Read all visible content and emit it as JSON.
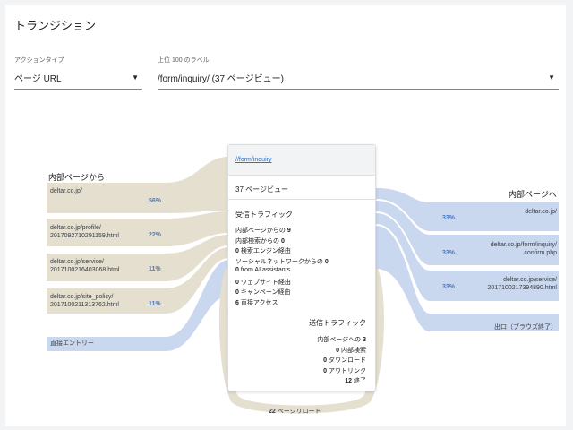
{
  "title": "トランジション",
  "filters": {
    "action_type_label": "アクションタイプ",
    "action_type_value": "ページ URL",
    "top_label": "上位 100 のラベル",
    "top_value": "/form/inquiry/ (37 ページビュー)"
  },
  "left": {
    "heading": "内部ページから",
    "items": [
      {
        "line1": "deltar.co.jp/",
        "line2": "",
        "pct": "56%"
      },
      {
        "line1": "deltar.co.jp/profile/",
        "line2": "2017092710291159.html",
        "pct": "22%"
      },
      {
        "line1": "deltar.co.jp/service/",
        "line2": "2017100216403068.html",
        "pct": "11%"
      },
      {
        "line1": "deltar.co.jp/site_policy/",
        "line2": "2017100211313762.html",
        "pct": "11%"
      }
    ],
    "direct": "直接エントリー"
  },
  "right": {
    "heading": "内部ページへ",
    "items": [
      {
        "line1": "deltar.co.jp/",
        "line2": "",
        "pct": "33%"
      },
      {
        "line1": "deltar.co.jp/form/inquiry/",
        "line2": "confirm.php",
        "pct": "33%"
      },
      {
        "line1": "deltar.co.jp/service/",
        "line2": "2017100217394890.html",
        "pct": "33%"
      }
    ],
    "exit": "出口（ブラウズ終了）"
  },
  "center": {
    "link": "//form/inquiry",
    "views": "37 ページビュー",
    "incoming_title": "受信トラフィック",
    "incoming": [
      {
        "pre": "内部ページからの ",
        "num": "9",
        "post": ""
      },
      {
        "pre": "内部検索からの ",
        "num": "0",
        "post": ""
      },
      {
        "pre": "",
        "num": "0",
        "post": " 検索エンジン経由"
      },
      {
        "pre": "ソーシャルネットワークからの ",
        "num": "0",
        "post": ""
      },
      {
        "pre": "",
        "num": "0",
        "post": " from AI assistants"
      },
      {
        "pre": "",
        "num": "0",
        "post": " ウェブサイト経由"
      },
      {
        "pre": "",
        "num": "0",
        "post": " キャンペーン経由"
      },
      {
        "pre": "",
        "num": "6",
        "post": " 直接アクセス"
      }
    ],
    "outgoing_title": "送信トラフィック",
    "outgoing": [
      {
        "pre": "内部ページへの ",
        "num": "3",
        "post": ""
      },
      {
        "pre": "",
        "num": "0",
        "post": " 内部検索"
      },
      {
        "pre": "",
        "num": "0",
        "post": " ダウンロード"
      },
      {
        "pre": "",
        "num": "0",
        "post": " アウトリンク"
      },
      {
        "pre": "",
        "num": "12",
        "post": " 終了"
      }
    ]
  },
  "reload": {
    "num": "22",
    "label": " ページリロード"
  },
  "colors": {
    "flow_tan": "#e4dfcf",
    "flow_blue": "#c9d7ef",
    "pct_blue": "#4a7ac4",
    "link": "#1a73e8"
  }
}
